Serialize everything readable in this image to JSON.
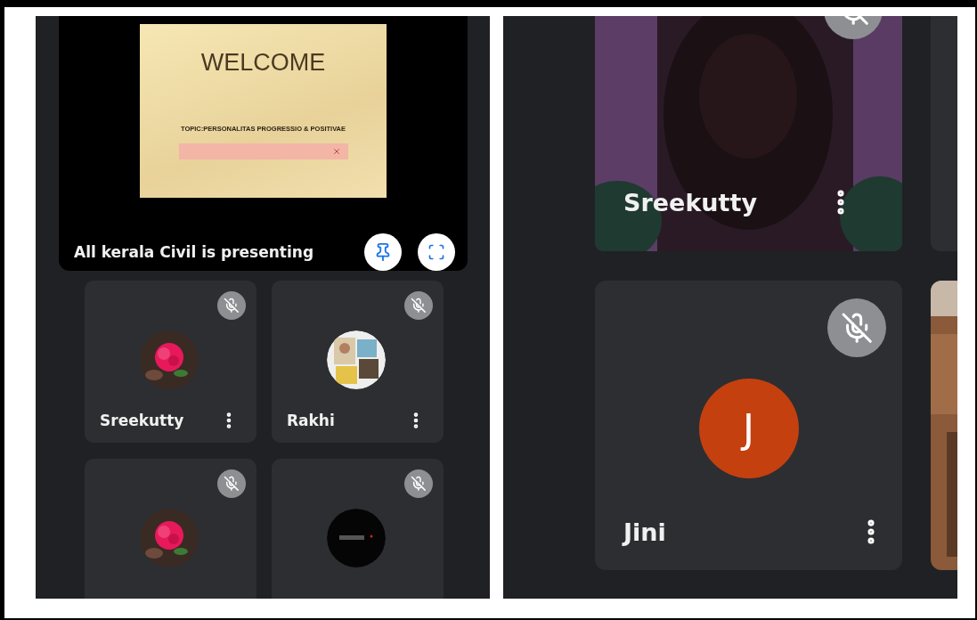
{
  "presentation": {
    "slide": {
      "title": "WELCOME",
      "topic": "TOPIC:PERSONALITAS PROGRESSIO  & POSITIVAE"
    },
    "caption": "All kerala Civil is presenting"
  },
  "left_tiles": [
    {
      "name": "Sreekutty",
      "muted": true
    },
    {
      "name": "Rakhi",
      "muted": true
    },
    {
      "muted": true
    },
    {
      "muted": true
    }
  ],
  "right_tiles": [
    {
      "kind": "video",
      "name": "Sreekutty",
      "muted": true
    },
    {
      "kind": "initial",
      "name": "Jini",
      "initial": "J",
      "muted": true
    }
  ]
}
